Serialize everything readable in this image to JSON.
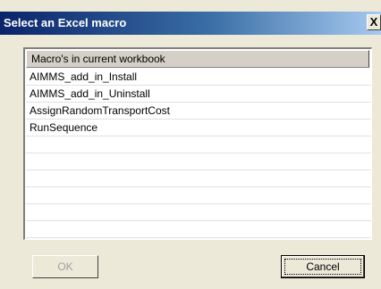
{
  "window": {
    "title": "Select an Excel macro",
    "close_glyph": "X"
  },
  "list": {
    "header": "Macro's in current workbook",
    "items": [
      "AIMMS_add_in_Install",
      "AIMMS_add_in_Uninstall",
      "AssignRandomTransportCost",
      "RunSequence"
    ]
  },
  "buttons": {
    "ok_label": "OK",
    "cancel_label": "Cancel"
  }
}
